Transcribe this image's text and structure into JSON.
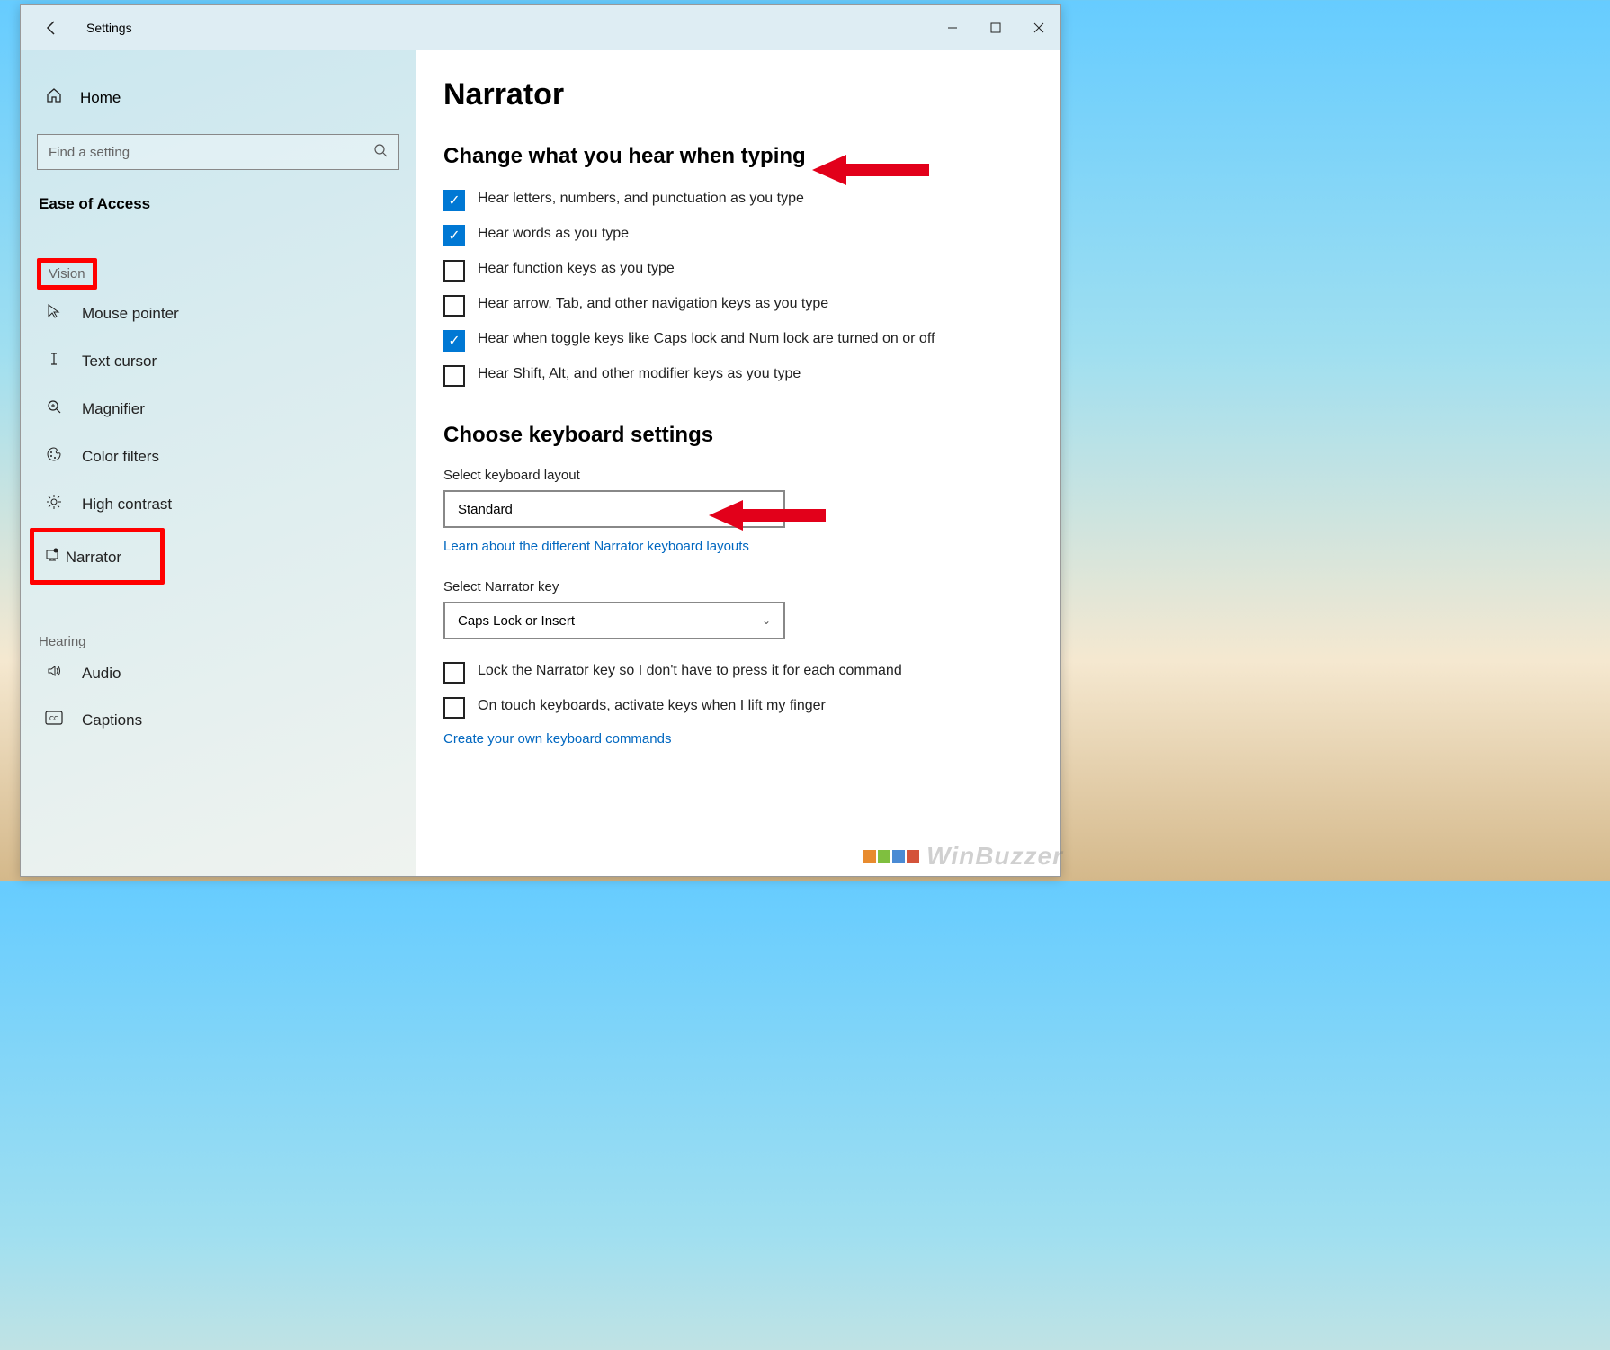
{
  "window": {
    "title": "Settings"
  },
  "sidebar": {
    "home": "Home",
    "search_placeholder": "Find a setting",
    "category": "Ease of Access",
    "group_vision": "Vision",
    "items_vision": [
      {
        "label": "Mouse pointer"
      },
      {
        "label": "Text cursor"
      },
      {
        "label": "Magnifier"
      },
      {
        "label": "Color filters"
      },
      {
        "label": "High contrast"
      },
      {
        "label": "Narrator"
      }
    ],
    "group_hearing": "Hearing",
    "items_hearing": [
      {
        "label": "Audio"
      },
      {
        "label": "Captions"
      }
    ]
  },
  "content": {
    "page_title": "Narrator",
    "section1_title": "Change what you hear when typing",
    "checks": [
      {
        "label": "Hear letters, numbers, and punctuation as you type",
        "checked": true
      },
      {
        "label": "Hear words as you type",
        "checked": true
      },
      {
        "label": "Hear function keys as you type",
        "checked": false
      },
      {
        "label": "Hear arrow, Tab, and other navigation keys as you type",
        "checked": false
      },
      {
        "label": "Hear when toggle keys like Caps lock and Num lock are turned on or off",
        "checked": true
      },
      {
        "label": "Hear Shift, Alt, and other modifier keys as you type",
        "checked": false
      }
    ],
    "section2_title": "Choose keyboard settings",
    "kb_layout_label": "Select keyboard layout",
    "kb_layout_value": "Standard",
    "kb_layout_link": "Learn about the different Narrator keyboard layouts",
    "narrator_key_label": "Select Narrator key",
    "narrator_key_value": "Caps Lock or Insert",
    "lock_key_check": {
      "label": "Lock the Narrator key so I don't have to press it for each command",
      "checked": false
    },
    "touch_check": {
      "label": "On touch keyboards, activate keys when I lift my finger",
      "checked": false
    },
    "commands_link": "Create your own keyboard commands"
  },
  "watermark": "WinBuzzer"
}
